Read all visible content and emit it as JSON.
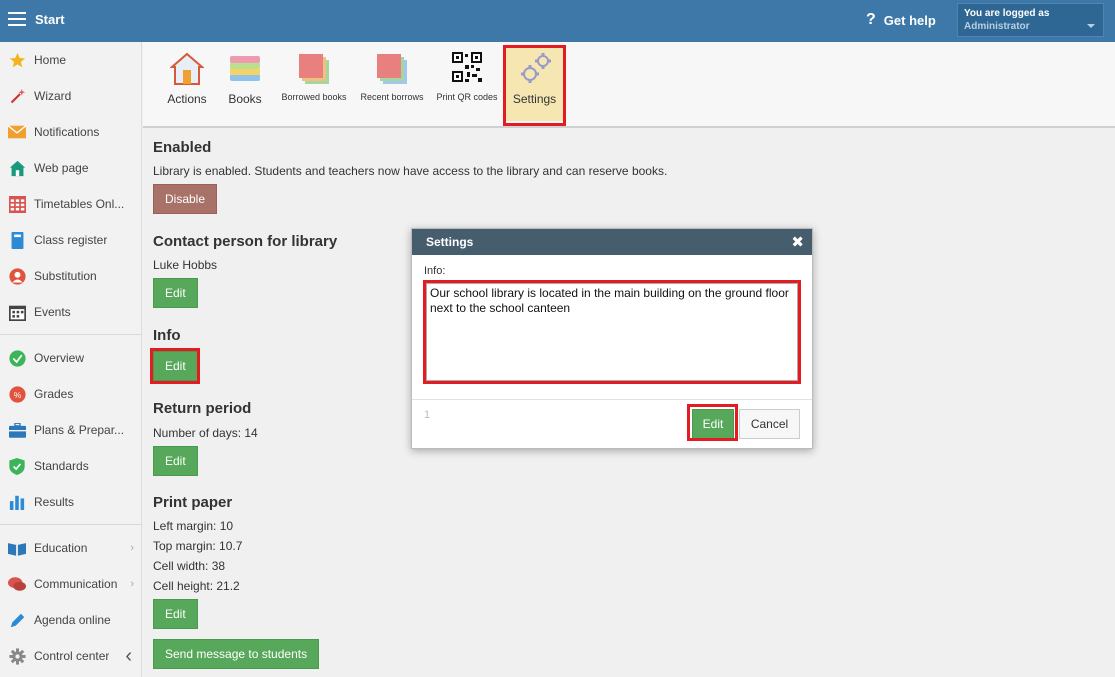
{
  "header": {
    "title": "Start",
    "help_label": "Get help",
    "login_line1": "You are logged as",
    "login_line2": "Administrator"
  },
  "sidebar": {
    "items": [
      {
        "label": "Home",
        "icon": "star-icon"
      },
      {
        "label": "Wizard",
        "icon": "wand-icon"
      },
      {
        "label": "Notifications",
        "icon": "envelope-icon"
      },
      {
        "label": "Web page",
        "icon": "house-icon"
      },
      {
        "label": "Timetables Onl...",
        "icon": "grid-calendar-icon"
      },
      {
        "label": "Class register",
        "icon": "book-icon"
      },
      {
        "label": "Substitution",
        "icon": "person-icon"
      },
      {
        "label": "Events",
        "icon": "calendar-icon"
      },
      {
        "label": "Overview",
        "icon": "check-circle-icon"
      },
      {
        "label": "Grades",
        "icon": "grades-icon"
      },
      {
        "label": "Plans & Prepar...",
        "icon": "briefcase-icon"
      },
      {
        "label": "Standards",
        "icon": "shield-check-icon"
      },
      {
        "label": "Results",
        "icon": "bar-chart-icon"
      },
      {
        "label": "Education",
        "icon": "open-book-icon"
      },
      {
        "label": "Communication",
        "icon": "chat-icon"
      },
      {
        "label": "Agenda online",
        "icon": "pen-icon"
      },
      {
        "label": "Control center",
        "icon": "gear-icon"
      }
    ]
  },
  "toolbar": {
    "actions": "Actions",
    "books": "Books",
    "borrowed": "Borrowed books",
    "recent": "Recent borrows",
    "qr": "Print QR codes",
    "settings": "Settings"
  },
  "content": {
    "enabled_title": "Enabled",
    "enabled_text": "Library is enabled. Students and teachers now have access to the library and can reserve books.",
    "disable_label": "Disable",
    "contact_title": "Contact person for library",
    "contact_name": "Luke Hobbs",
    "info_title": "Info",
    "return_title": "Return period",
    "return_text": "Number of days: 14",
    "print_title": "Print paper",
    "left_margin": "Left margin: 10",
    "top_margin": "Top margin: 10.7",
    "cell_width": "Cell width: 38",
    "cell_height": "Cell height: 21.2",
    "edit_label": "Edit",
    "send_label": "Send message to students"
  },
  "modal": {
    "title": "Settings",
    "field_label": "Info:",
    "field_value": "Our school library is located in the main building on the ground floor next to the school canteen",
    "count": "1",
    "edit_label": "Edit",
    "cancel_label": "Cancel"
  },
  "colors": {
    "header": "#3d78a8",
    "edit_green": "#57a85a",
    "highlight_red": "#e31b23",
    "modal_header": "#455d6d"
  }
}
